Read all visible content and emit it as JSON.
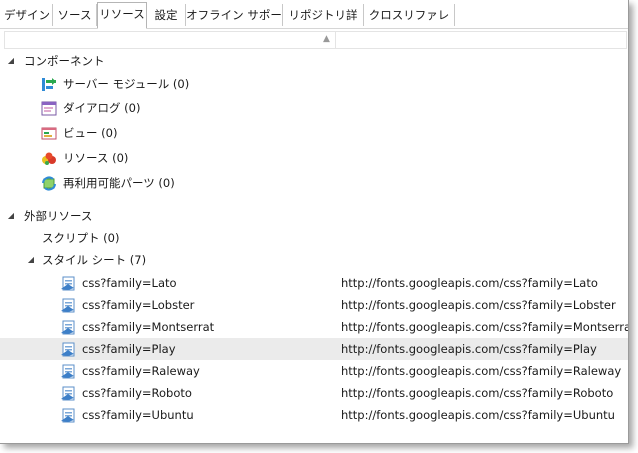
{
  "tabs": [
    {
      "label": "デザイン"
    },
    {
      "label": "ソース"
    },
    {
      "label": "リソース"
    },
    {
      "label": "設定"
    },
    {
      "label": "オフライン サポート"
    },
    {
      "label": "リポジトリ詳細"
    },
    {
      "label": "クロスリファレンス"
    }
  ],
  "tree": {
    "components": {
      "label": "コンポーネント",
      "items": [
        {
          "label": "サーバー モジュール (0)",
          "icon": "server-module-icon"
        },
        {
          "label": "ダイアログ (0)",
          "icon": "dialog-icon"
        },
        {
          "label": "ビュー (0)",
          "icon": "view-icon"
        },
        {
          "label": "リソース (0)",
          "icon": "resource-icon"
        },
        {
          "label": "再利用可能パーツ (0)",
          "icon": "reusable-part-icon"
        }
      ]
    },
    "external": {
      "label": "外部リソース",
      "scripts": {
        "label": "スクリプト (0)"
      },
      "stylesheets": {
        "label": "スタイル シート (7)",
        "items": [
          {
            "name": "css?family=Lato",
            "url": "http://fonts.googleapis.com/css?family=Lato"
          },
          {
            "name": "css?family=Lobster",
            "url": "http://fonts.googleapis.com/css?family=Lobster"
          },
          {
            "name": "css?family=Montserrat",
            "url": "http://fonts.googleapis.com/css?family=Montserrat"
          },
          {
            "name": "css?family=Play",
            "url": "http://fonts.googleapis.com/css?family=Play"
          },
          {
            "name": "css?family=Raleway",
            "url": "http://fonts.googleapis.com/css?family=Raleway"
          },
          {
            "name": "css?family=Roboto",
            "url": "http://fonts.googleapis.com/css?family=Roboto"
          },
          {
            "name": "css?family=Ubuntu",
            "url": "http://fonts.googleapis.com/css?family=Ubuntu"
          }
        ]
      }
    }
  },
  "colors": {
    "selected_row": "#ebebeb",
    "tab_border": "#b5b5b5"
  }
}
